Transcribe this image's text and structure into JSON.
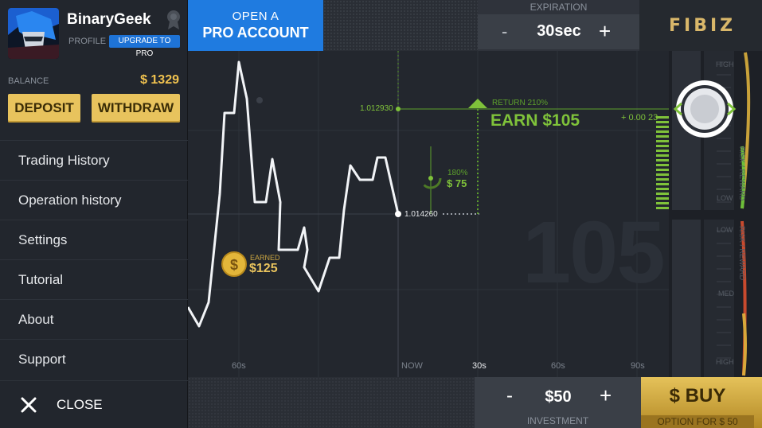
{
  "profile": {
    "username": "BinaryGeek",
    "profile_label": "PROFILE",
    "upgrade_label": "UPGRADE TO PRO"
  },
  "balance": {
    "label": "BALANCE",
    "value": "$ 1329"
  },
  "actions": {
    "deposit": "DEPOSIT",
    "withdraw": "WITHDRAW"
  },
  "menu": {
    "items": [
      "Trading History",
      "Operation history",
      "Settings",
      "Tutorial",
      "About",
      "Support"
    ],
    "close_label": "CLOSE"
  },
  "topbar": {
    "pro_line1": "OPEN A",
    "pro_line2": "PRO ACCOUNT",
    "expiration_label": "EXPIRATION",
    "expiration_value": "30sec",
    "minus": "-",
    "plus": "+",
    "logo": "FIBIZ"
  },
  "chart": {
    "big_number": "105",
    "target_price": "1.012930",
    "current_price": "1.014260",
    "return_label": "RETURN 210%",
    "earn_label": "EARN $105",
    "delta_label": "+ 0.00 23",
    "alt_percent": "180%",
    "alt_amount": "$ 75",
    "earned_label": "EARNED",
    "earned_amount": "$125",
    "x_labels": [
      "60s",
      "NOW",
      "30s",
      "60s",
      "90s"
    ]
  },
  "gauge": {
    "high_top": "HIGH",
    "low_top": "LOW",
    "low_bottom": "LOW",
    "med_bottom": "MED",
    "high_bottom": "HIGH",
    "risk_reward_top": "RISK / REWARD",
    "risk_reward_bottom": "RISK / REWARD"
  },
  "bottombar": {
    "minus": "-",
    "investment_value": "$50",
    "plus": "+",
    "investment_label": "INVESTMENT",
    "buy_label": "$ BUY",
    "buy_sub": "OPTION FOR $ 50"
  },
  "colors": {
    "accent_blue": "#1f7be0",
    "gold": "#e8c35d",
    "green": "#7fc23a"
  }
}
